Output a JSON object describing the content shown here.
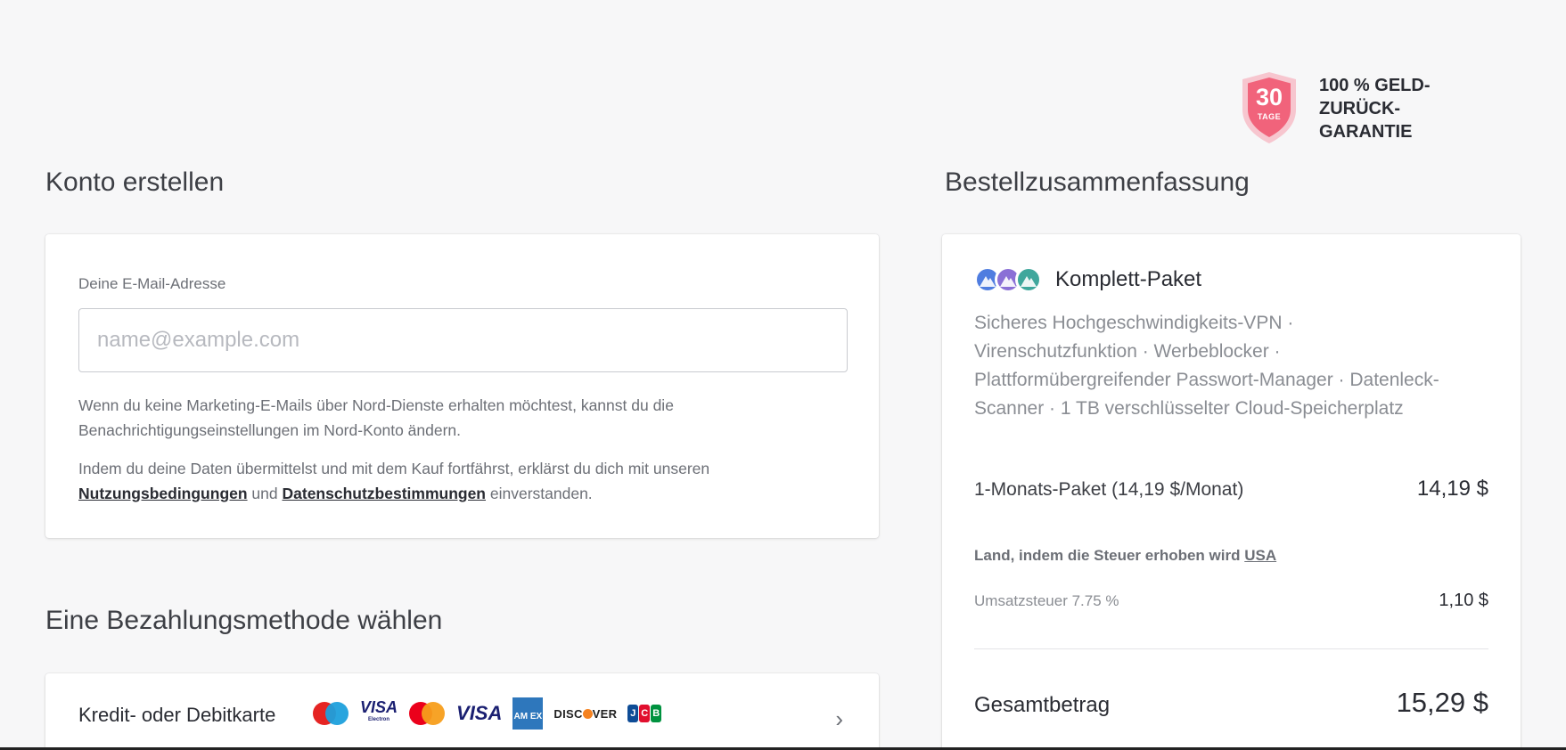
{
  "guarantee": {
    "days": "30",
    "days_label": "TAGE",
    "text": "100 % GELD-ZURÜCK-GARANTIE",
    "color": "#f1637b"
  },
  "account": {
    "heading": "Konto erstellen",
    "email_label": "Deine E-Mail-Adresse",
    "email_placeholder": "name@example.com",
    "email_value": "",
    "note_marketing": "Wenn du keine Marketing-E-Mails über Nord-Dienste erhalten möchtest, kannst du die Benachrichtigungseinstellungen im Nord-Konto ändern.",
    "note_terms_prefix": "Indem du deine Daten übermittelst und mit dem Kauf fortfährst, erklärst du dich mit unseren ",
    "terms_link": "Nutzungsbedingungen",
    "note_terms_and": " und ",
    "privacy_link": "Datenschutzbestimmungen",
    "note_terms_suffix": " einverstanden."
  },
  "payment": {
    "heading": "Eine Bezahlungsmethode wählen",
    "method_label": "Kredit- oder Debitkarte",
    "card_logos": [
      "maestro-logo",
      "visa-electron-logo",
      "mastercard-logo",
      "visa-logo",
      "amex-logo",
      "discover-logo",
      "jcb-logo"
    ],
    "visa_text": "VISA",
    "visa_electron_sub": "Electron",
    "amex_text": "AM EX",
    "discover_text_1": "DISC",
    "discover_text_2": "VER",
    "jcb_letters": [
      "J",
      "C",
      "B"
    ]
  },
  "summary": {
    "heading": "Bestellzusammenfassung",
    "product_title": "Komplett-Paket",
    "product_description": "Sicheres Hochgeschwindigkeits-VPN · Virenschutzfunktion · Werbeblocker · Plattformübergreifender Passwort-Manager · Datenleck-Scanner · 1 TB verschlüsselter Cloud-Speicherplatz",
    "plan_label": "1-Monats-Paket (14,19 $/Monat)",
    "plan_price": "14,19 $",
    "tax_country_label": "Land, indem die Steuer erhoben wird",
    "tax_country": "USA",
    "vat_label": "Umsatzsteuer 7.75 %",
    "vat_amount": "1,10 $",
    "total_label": "Gesamtbetrag",
    "total_amount": "15,29 $"
  },
  "colors": {
    "background": "#f7f7f8",
    "text_dark": "#2a2c33",
    "text_muted": "#8a8d93",
    "badge_pink": "#f1637b"
  }
}
